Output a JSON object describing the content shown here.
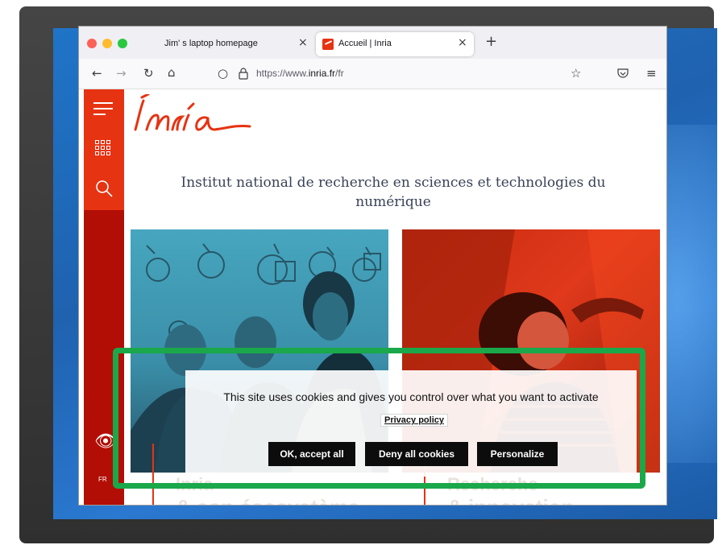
{
  "browser": {
    "tabs": [
      {
        "label": "Jim' s laptop homepage",
        "active": false
      },
      {
        "label": "Accueil | Inria",
        "active": true
      }
    ],
    "url_prefix": "https://www.",
    "url_domain": "inria.fr",
    "url_path": "/fr"
  },
  "site": {
    "tagline": "Institut national de recherche en sciences et technologies du numérique",
    "language": "FR",
    "card_left_title": "Inria",
    "card_left_subtitle": "& son écosystème",
    "card_right_title": "Recherche",
    "card_right_subtitle": "& innovation"
  },
  "cookie_banner": {
    "message": "This site uses cookies and gives you control over what you want to activate",
    "privacy_link": "Privacy policy",
    "accept_all": "OK, accept all",
    "deny_all": "Deny all cookies",
    "personalize": "Personalize"
  },
  "colors": {
    "inria_red": "#e63312",
    "sidebar_dark_red": "#b20e06",
    "highlight_green": "#1aa84a",
    "button_black": "#0c0c0c"
  }
}
